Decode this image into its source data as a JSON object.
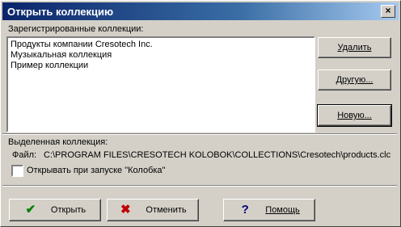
{
  "window": {
    "title": "Открыть коллекцию",
    "close_label": "×"
  },
  "registered": {
    "label": "Зарегистрированные коллекции:",
    "items": [
      "Продукты компании Cresotech Inc.",
      "Музыкальная коллекция",
      "Пример коллекции"
    ]
  },
  "buttons": {
    "delete": "Удалить",
    "other": "Другую...",
    "new": "Новую..."
  },
  "selected": {
    "label": "Выделенная коллекция:",
    "file_label": "Файл:",
    "file_path": "C:\\PROGRAM FILES\\CRESOTECH KOLOBOK\\COLLECTIONS\\Cresotech\\products.clc",
    "startup_checkbox": "Открывать при запуске \"Колобка\"",
    "startup_checked": false
  },
  "footer": {
    "open": "Открыть",
    "cancel": "Отменить",
    "help": "Помощь"
  },
  "icons": {
    "open": "check-icon",
    "cancel": "cross-icon",
    "help": "question-icon"
  },
  "colors": {
    "check": "#008000",
    "cross": "#c00000",
    "help": "#000080"
  }
}
